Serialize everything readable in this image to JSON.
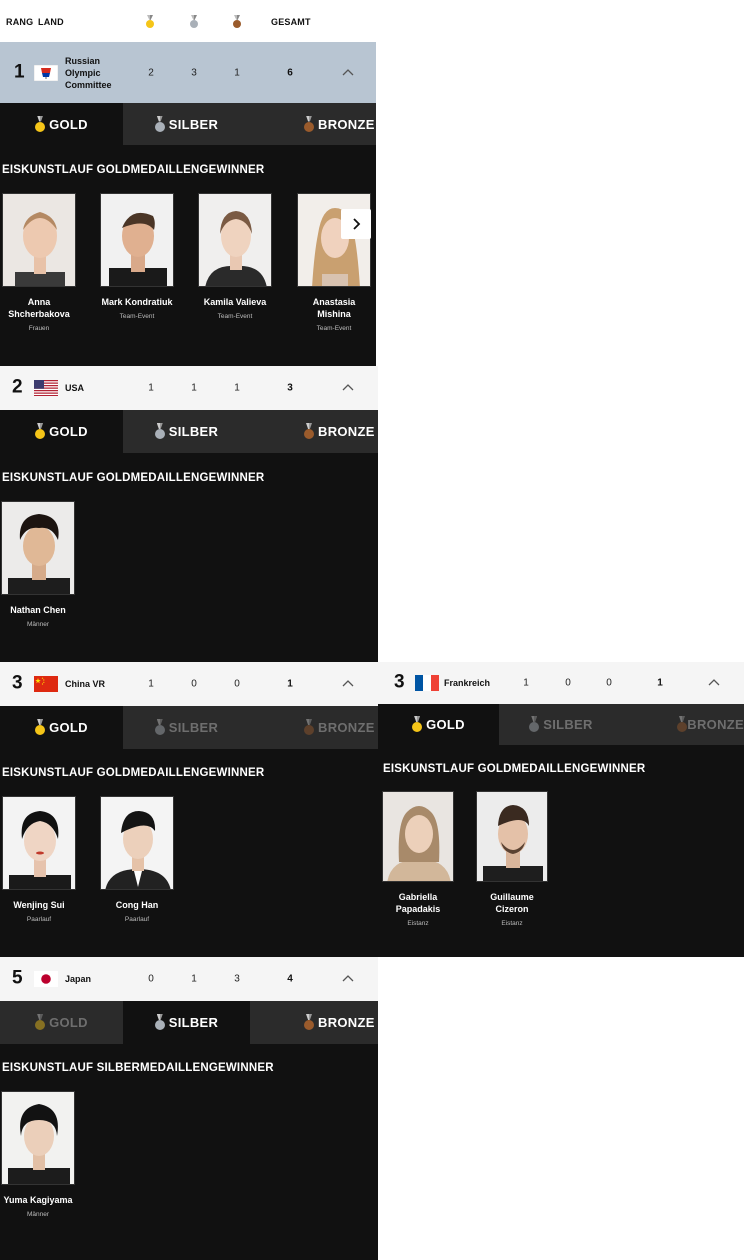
{
  "header": {
    "rank": "RANG",
    "country": "LAND",
    "total": "GESAMT"
  },
  "colors": {
    "gold": "#f5c518",
    "silver": "#a9b0b8",
    "bronze": "#9a5b2c",
    "highlight_row": "#b8c5d2"
  },
  "tabs": {
    "gold": "GOLD",
    "silver": "SILBER",
    "bronze": "BRONZE"
  },
  "countries": [
    {
      "rank": "1",
      "name": "Russian Olympic Committee",
      "gold": "2",
      "silver": "3",
      "bronze": "1",
      "total": "6",
      "active_tab": "gold",
      "section_title": "EISKUNSTLAUF GOLDMEDAILLENGEWINNER",
      "athletes": [
        {
          "name": "Anna Shcherbakova",
          "event": "Frauen"
        },
        {
          "name": "Mark Kondratiuk",
          "event": "Team-Event"
        },
        {
          "name": "Kamila Valieva",
          "event": "Team-Event"
        },
        {
          "name": "Anastasia Mishina",
          "event": "Team-Event"
        }
      ]
    },
    {
      "rank": "2",
      "name": "USA",
      "gold": "1",
      "silver": "1",
      "bronze": "1",
      "total": "3",
      "active_tab": "gold",
      "section_title": "EISKUNSTLAUF GOLDMEDAILLENGEWINNER",
      "athletes": [
        {
          "name": "Nathan Chen",
          "event": "Männer"
        }
      ]
    },
    {
      "rank": "3",
      "name": "China VR",
      "gold": "1",
      "silver": "0",
      "bronze": "0",
      "total": "1",
      "active_tab": "gold",
      "section_title": "EISKUNSTLAUF GOLDMEDAILLENGEWINNER",
      "athletes": [
        {
          "name": "Wenjing Sui",
          "event": "Paarlauf"
        },
        {
          "name": "Cong Han",
          "event": "Paarlauf"
        }
      ]
    },
    {
      "rank": "3",
      "name": "Frankreich",
      "gold": "1",
      "silver": "0",
      "bronze": "0",
      "total": "1",
      "active_tab": "gold",
      "section_title": "EISKUNSTLAUF GOLDMEDAILLENGEWINNER",
      "athletes": [
        {
          "name": "Gabriella Papadakis",
          "event": "Eistanz"
        },
        {
          "name": "Guillaume Cizeron",
          "event": "Eistanz"
        }
      ]
    },
    {
      "rank": "5",
      "name": "Japan",
      "gold": "0",
      "silver": "1",
      "bronze": "3",
      "total": "4",
      "active_tab": "silver",
      "section_title": "EISKUNSTLAUF SILBERMEDAILLENGEWINNER",
      "athletes": [
        {
          "name": "Yuma Kagiyama",
          "event": "Männer"
        }
      ]
    }
  ]
}
